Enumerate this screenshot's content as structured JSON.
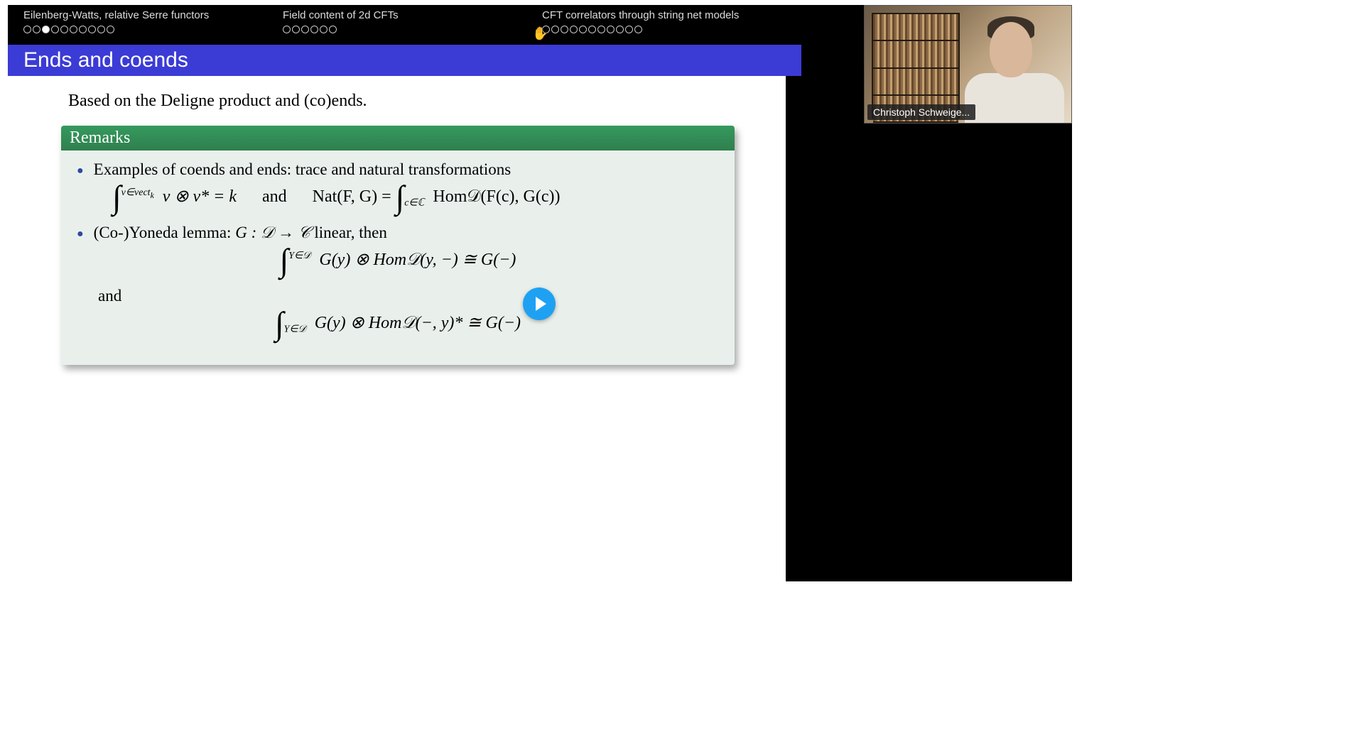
{
  "nav": {
    "sections": [
      {
        "title": "Eilenberg-Watts, relative Serre functors",
        "total": 10,
        "current": 3
      },
      {
        "title": "Field content of 2d CFTs",
        "total": 6,
        "current": 0
      },
      {
        "title": "CFT correlators through string net models",
        "total": 11,
        "current": 0
      }
    ]
  },
  "slide": {
    "title": "Ends and coends",
    "intro": "Based on the Deligne product and (co)ends.",
    "block_title": "Remarks",
    "bullet1": "Examples of coends and ends: trace and natural transformations",
    "eq1_left_bound": "v∈vect",
    "eq1_left_bound_sub": "k",
    "eq1_left_body": "v ⊗ v* = k",
    "eq1_and": "and",
    "eq1_right_lhs": "Nat(F, G) = ",
    "eq1_right_bound": "c∈ℂ",
    "eq1_right_body": "Hom𝒟(F(c), G(c))",
    "bullet2_pre": "(Co-)Yoneda lemma: ",
    "bullet2_math": "G : 𝒟 → 𝒞",
    "bullet2_post": " linear, then",
    "eq2_bound": "Y∈𝒟",
    "eq2_body": "G(y) ⊗ Hom𝒟(y, −) ≅ G(−)",
    "and_text": "and",
    "eq3_bound": "Y∈𝒟",
    "eq3_body": "G(y) ⊗ Hom𝒟(−, y)* ≅ G(−)"
  },
  "webcam": {
    "name": "Christoph Schweige..."
  },
  "colors": {
    "title_bar": "#3b3bd6",
    "block_header": "#2f8a55",
    "play_button": "#1ea1f2"
  }
}
